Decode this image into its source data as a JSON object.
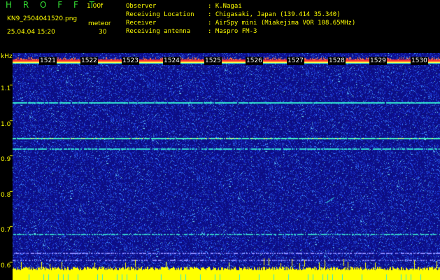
{
  "header": {
    "app_name": "H R O F F T",
    "version": "1.00f",
    "filename": "KN9_2504041520.png",
    "algorithm": "meteor",
    "datetime": "25.04.04 15:20",
    "count": "30",
    "info": [
      {
        "label": "Observer",
        "value": ": K.Nagai"
      },
      {
        "label": "Receiving Location",
        "value": ": Chigasaki, Japan (139.414 35.340)"
      },
      {
        "label": "Receiver",
        "value": ": AirSpy mini (Miakejima VOR 108.65MHz)"
      },
      {
        "label": "Receiving antenna",
        "value": ": Maspro FM-3"
      }
    ]
  },
  "spectrogram": {
    "y_unit": "kHz",
    "y_ticks": [
      "1.1",
      "1.0",
      "0.9",
      "0.8",
      "0.7",
      "0.6"
    ],
    "time_labels": [
      "1521",
      "1522",
      "1523",
      "1524",
      "1525",
      "1526",
      "1527",
      "1528",
      "1529",
      "1530"
    ],
    "colors": {
      "background": "#10108c",
      "noise": "#2244ff",
      "line": "#33e8d0",
      "yellow": "#ffff00",
      "red": "#ff3030"
    }
  }
}
